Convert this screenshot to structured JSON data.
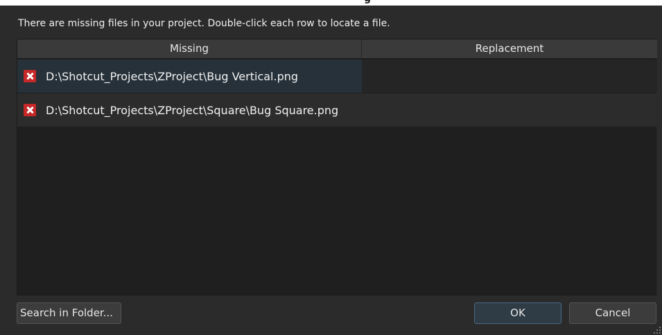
{
  "window": {
    "title_fragment": "g"
  },
  "message": "There are missing files in your project. Double-click each row to locate a file.",
  "table": {
    "columns": [
      "Missing",
      "Replacement"
    ],
    "rows": [
      {
        "icon": "error-x-icon",
        "missing": "D:\\Shotcut_Projects\\ZProject\\Bug Vertical.png",
        "replacement": ""
      },
      {
        "icon": "error-x-icon",
        "missing": "D:\\Shotcut_Projects\\ZProject\\Square\\Bug Square.png",
        "replacement": ""
      }
    ]
  },
  "buttons": {
    "search": "Search in Folder...",
    "ok": "OK",
    "cancel": "Cancel"
  },
  "colors": {
    "background": "#2b2b2b",
    "error_icon": "#c62828",
    "selected_row": "#26313a",
    "ok_border": "#4a6b85"
  }
}
